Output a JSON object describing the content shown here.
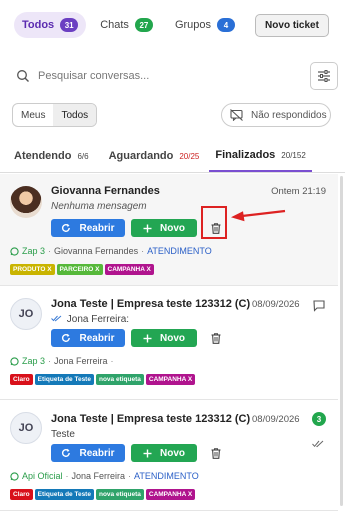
{
  "top_tabs": [
    {
      "label": "Todos",
      "count": "31",
      "color": "#6b3fc2"
    },
    {
      "label": "Chats",
      "count": "27",
      "color": "#22a64d"
    },
    {
      "label": "Grupos",
      "count": "4",
      "color": "#2a6fd6"
    }
  ],
  "new_ticket_label": "Novo ticket",
  "search": {
    "placeholder": "Pesquisar conversas..."
  },
  "view_toggle": {
    "options": [
      "Meus",
      "Todos"
    ],
    "selected": "Todos"
  },
  "unanswered_label": "Não respondidos",
  "status_tabs": [
    {
      "label": "Atendendo",
      "count": "6/6"
    },
    {
      "label": "Aguardando",
      "count": "20/25"
    },
    {
      "label": "Finalizados",
      "count": "20/152"
    }
  ],
  "buttons": {
    "reopen": "Reabrir",
    "new": "Novo"
  },
  "tickets": [
    {
      "initials": "",
      "name": "Giovanna Fernandes",
      "time": "Ontem 21:19",
      "message": "Nenhuma mensagem",
      "connection": "Zap 3",
      "contact": "Giovanna Fernandes",
      "queue": "ATENDIMENTO",
      "tags": [
        {
          "label": "PRODUTO X",
          "color": "#c9b400"
        },
        {
          "label": "PARCEIRO X",
          "color": "#56b83a"
        },
        {
          "label": "CAMPANHA X",
          "color": "#b0148e"
        }
      ]
    },
    {
      "initials": "JO",
      "name": "Jona Teste | Empresa teste 123312 (C)",
      "time": "08/09/2026",
      "message": "Jona Ferreira:",
      "connection": "Zap 3",
      "contact": "Jona Ferreira",
      "queue": "",
      "tags": [
        {
          "label": "Claro",
          "color": "#d8101a"
        },
        {
          "label": "Etiqueta de Teste",
          "color": "#1479b8"
        },
        {
          "label": "nova etiqueta",
          "color": "#2fa36a"
        },
        {
          "label": "CAMPANHA X",
          "color": "#b0148e"
        }
      ]
    },
    {
      "initials": "JO",
      "name": "Jona Teste | Empresa teste 123312 (C)",
      "time": "08/09/2026",
      "message": "Teste",
      "unread": "3",
      "connection": "Api Oficial",
      "contact": "Jona Ferreira",
      "queue": "ATENDIMENTO",
      "tags": [
        {
          "label": "Claro",
          "color": "#d8101a"
        },
        {
          "label": "Etiqueta de Teste",
          "color": "#1479b8"
        },
        {
          "label": "nova etiqueta",
          "color": "#2fa36a"
        },
        {
          "label": "CAMPANHA X",
          "color": "#b0148e"
        }
      ]
    }
  ],
  "colors": {
    "accent": "#7a4fd1",
    "reopen": "#2d7ae0",
    "new": "#23a653",
    "annotation": "#dd2222"
  }
}
